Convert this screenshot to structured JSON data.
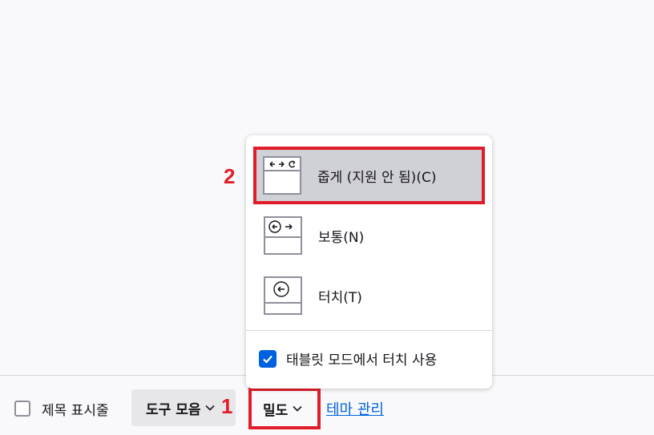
{
  "bottom_bar": {
    "title_bar_label": "제목 표시줄",
    "toolbars_label": "도구 모음",
    "density_label": "밀도",
    "manage_themes_label": "테마 관리"
  },
  "density_menu": {
    "options": [
      {
        "label": "줍게 (지원 안 됨)(C)",
        "icon": "compact-density-icon",
        "highlighted": true
      },
      {
        "label": "보통(N)",
        "icon": "normal-density-icon"
      },
      {
        "label": "터치(T)",
        "icon": "touch-density-icon"
      }
    ],
    "tablet_mode_label": "태블릿 모드에서 터치 사용",
    "tablet_mode_checked": true
  },
  "annotations": {
    "step_1": "1",
    "step_2": "2"
  },
  "colors": {
    "highlight_border": "#e11d2a",
    "accent": "#0061e0",
    "selected_bg": "#d0d0d7"
  }
}
